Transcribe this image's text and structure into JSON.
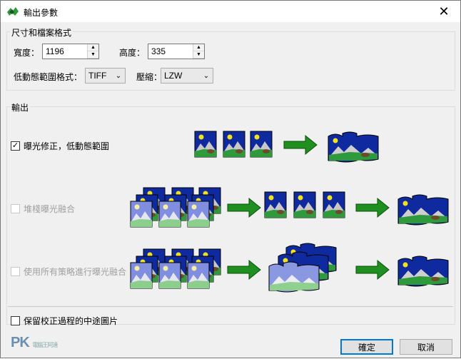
{
  "window": {
    "title": "輸出參數"
  },
  "size_group": {
    "label": "尺寸和檔案格式",
    "width_label": "寬度：",
    "width_value": "1196",
    "height_label": "高度：",
    "height_value": "335",
    "hdr_format_label": "低動態範圍格式：",
    "hdr_format_value": "TIFF",
    "compression_label": "壓縮：",
    "compression_value": "LZW"
  },
  "output_group": {
    "label": "輸出",
    "options": [
      {
        "label": "曝光修正，低動態範圍",
        "checked": true,
        "enabled": true
      },
      {
        "label": "堆棧曝光融合",
        "checked": false,
        "enabled": false
      },
      {
        "label": "使用所有策略進行曝光融合",
        "checked": false,
        "enabled": false
      }
    ]
  },
  "keep_intermediate": {
    "label": "保留校正過程的中途圖片",
    "checked": false
  },
  "buttons": {
    "ok": "確定",
    "cancel": "取消"
  },
  "watermark": {
    "text": "PK",
    "subtext": "電腦王阿達"
  }
}
